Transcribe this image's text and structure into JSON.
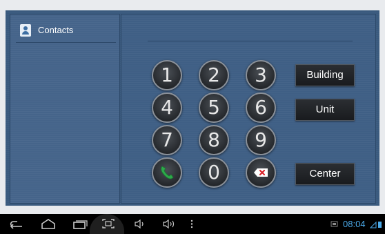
{
  "sidebar": {
    "title": "Contacts",
    "icon": "contacts-icon"
  },
  "keypad": {
    "keys": [
      {
        "label": "1",
        "name": "key-1"
      },
      {
        "label": "2",
        "name": "key-2"
      },
      {
        "label": "3",
        "name": "key-3"
      },
      {
        "label": "4",
        "name": "key-4"
      },
      {
        "label": "5",
        "name": "key-5"
      },
      {
        "label": "6",
        "name": "key-6"
      },
      {
        "label": "7",
        "name": "key-7"
      },
      {
        "label": "8",
        "name": "key-8"
      },
      {
        "label": "9",
        "name": "key-9"
      },
      {
        "label": "",
        "name": "call-key",
        "icon": "phone-icon"
      },
      {
        "label": "0",
        "name": "key-0"
      },
      {
        "label": "",
        "name": "delete-key",
        "icon": "backspace-icon"
      }
    ],
    "call_color": "#2ea84a",
    "delete_color": "#d9232a"
  },
  "buttons": {
    "building": "Building",
    "unit": "Unit",
    "center": "Center"
  },
  "status": {
    "time": "08:04",
    "accent": "#4ba9e8"
  },
  "navbar": {
    "icons": [
      "back-icon",
      "home-icon",
      "recent-apps-icon",
      "screenshot-icon",
      "volume-down-icon",
      "volume-up-icon",
      "menu-icon"
    ]
  }
}
